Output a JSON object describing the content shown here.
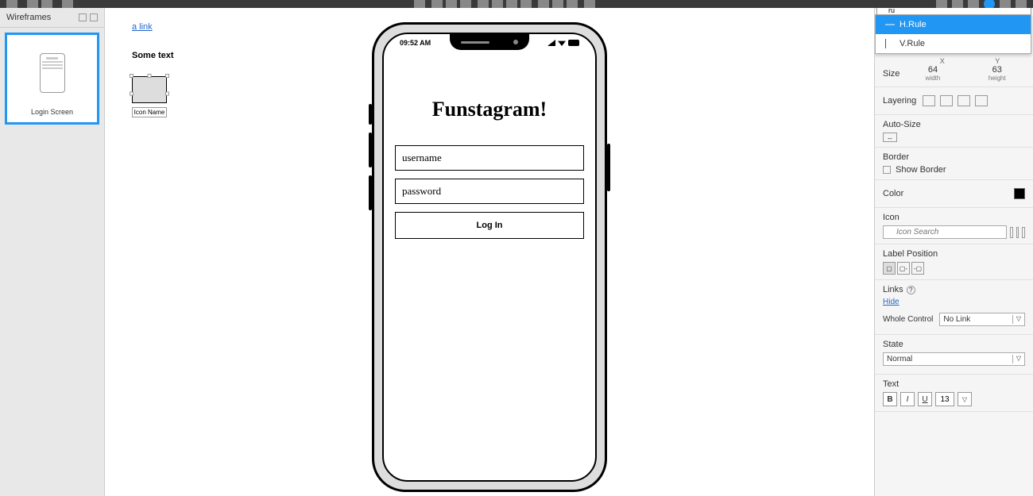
{
  "toolbar": {},
  "sidebar": {
    "title": "Wireframes",
    "thumbnail_label": "Login Screen"
  },
  "canvas": {
    "link_text": "a link",
    "some_text": "Some text",
    "icon_widget_label": "Icon Name"
  },
  "phone": {
    "time": "09:52 AM",
    "title": "Funstagram!",
    "username_placeholder": "username",
    "password_placeholder": "password",
    "login_button": "Log In"
  },
  "dropdown": {
    "search_value": "ru",
    "items": [
      {
        "label": "H.Rule",
        "selected": true
      },
      {
        "label": "V.Rule",
        "selected": false
      }
    ]
  },
  "inspector": {
    "coords": {
      "x_label": "X",
      "y_label": "Y"
    },
    "size": {
      "label": "Size",
      "width": "64",
      "height": "63",
      "width_label": "width",
      "height_label": "height"
    },
    "layering_label": "Layering",
    "autosize_label": "Auto-Size",
    "border_label": "Border",
    "show_border_label": "Show Border",
    "color_label": "Color",
    "color_value": "#000000",
    "icon_label": "Icon",
    "icon_search_placeholder": "Icon Search",
    "label_position_label": "Label Position",
    "links_label": "Links",
    "hide_label": "Hide",
    "whole_control_label": "Whole Control",
    "whole_control_value": "No Link",
    "state_label": "State",
    "state_value": "Normal",
    "text_label": "Text",
    "text_size": "13",
    "bold": "B",
    "italic": "I",
    "underline": "U"
  }
}
